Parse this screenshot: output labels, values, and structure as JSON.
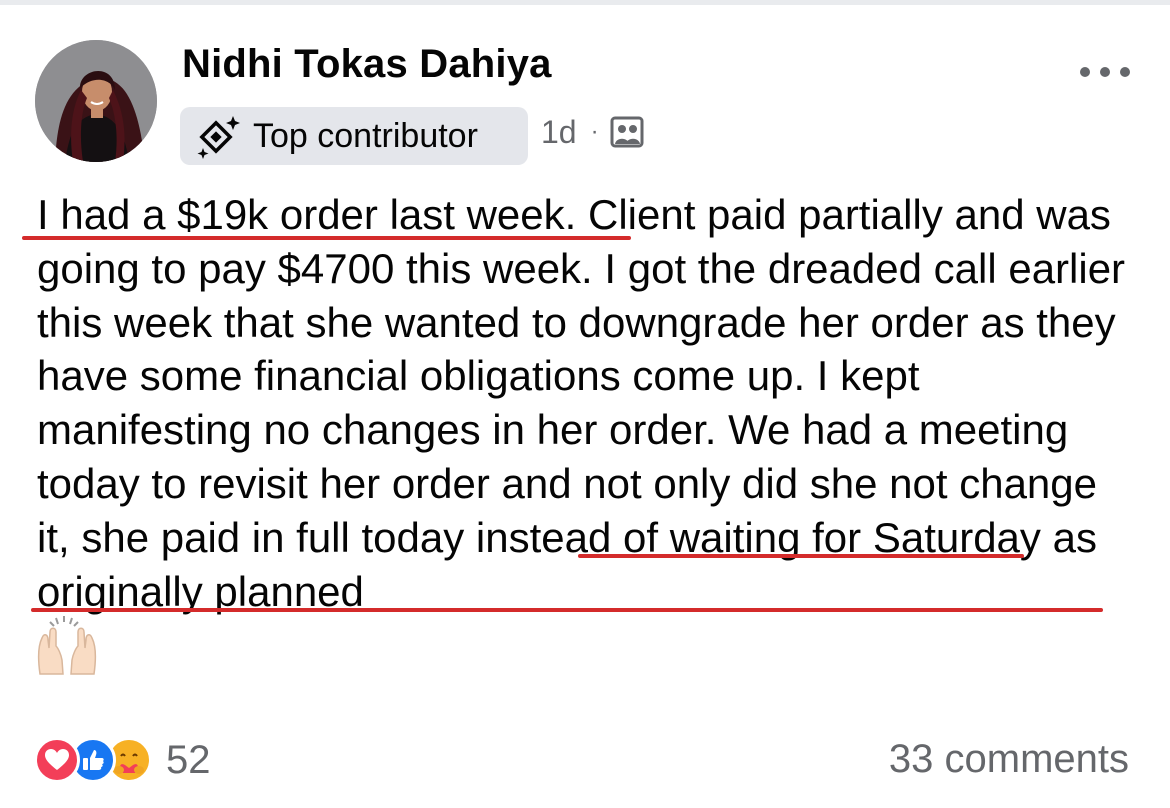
{
  "post": {
    "author": "Nidhi Tokas Dahiya",
    "badge_label": "Top contributor",
    "timestamp": "1d",
    "separator": "·",
    "audience_icon": "group-audience-icon",
    "badge_icon": "top-contributor-icon",
    "more_icon": "more-options-icon",
    "text": "I had a $19k order last week. Client paid partially and was going to pay $4700 this week. I got the dreaded call earlier this week that she wanted to downgrade her order as they have some financial obligations come up. I kept manifesting no changes in her order. We had a meeting today to revisit her order and not only did she not change it, she paid in full today instead of waiting for Saturday as originally planned",
    "emoji": "raising-hands-emoji",
    "highlight_color": "#d42b2b"
  },
  "footer": {
    "reaction_icons": [
      "love-reaction-icon",
      "like-reaction-icon",
      "care-reaction-icon"
    ],
    "reaction_count": "52",
    "comments": "33 comments"
  },
  "colors": {
    "text": "#050505",
    "secondary": "#65676b",
    "badge_bg": "#e4e6eb",
    "love": "#f33e58",
    "like": "#1877f2",
    "care": "#f7b125"
  }
}
